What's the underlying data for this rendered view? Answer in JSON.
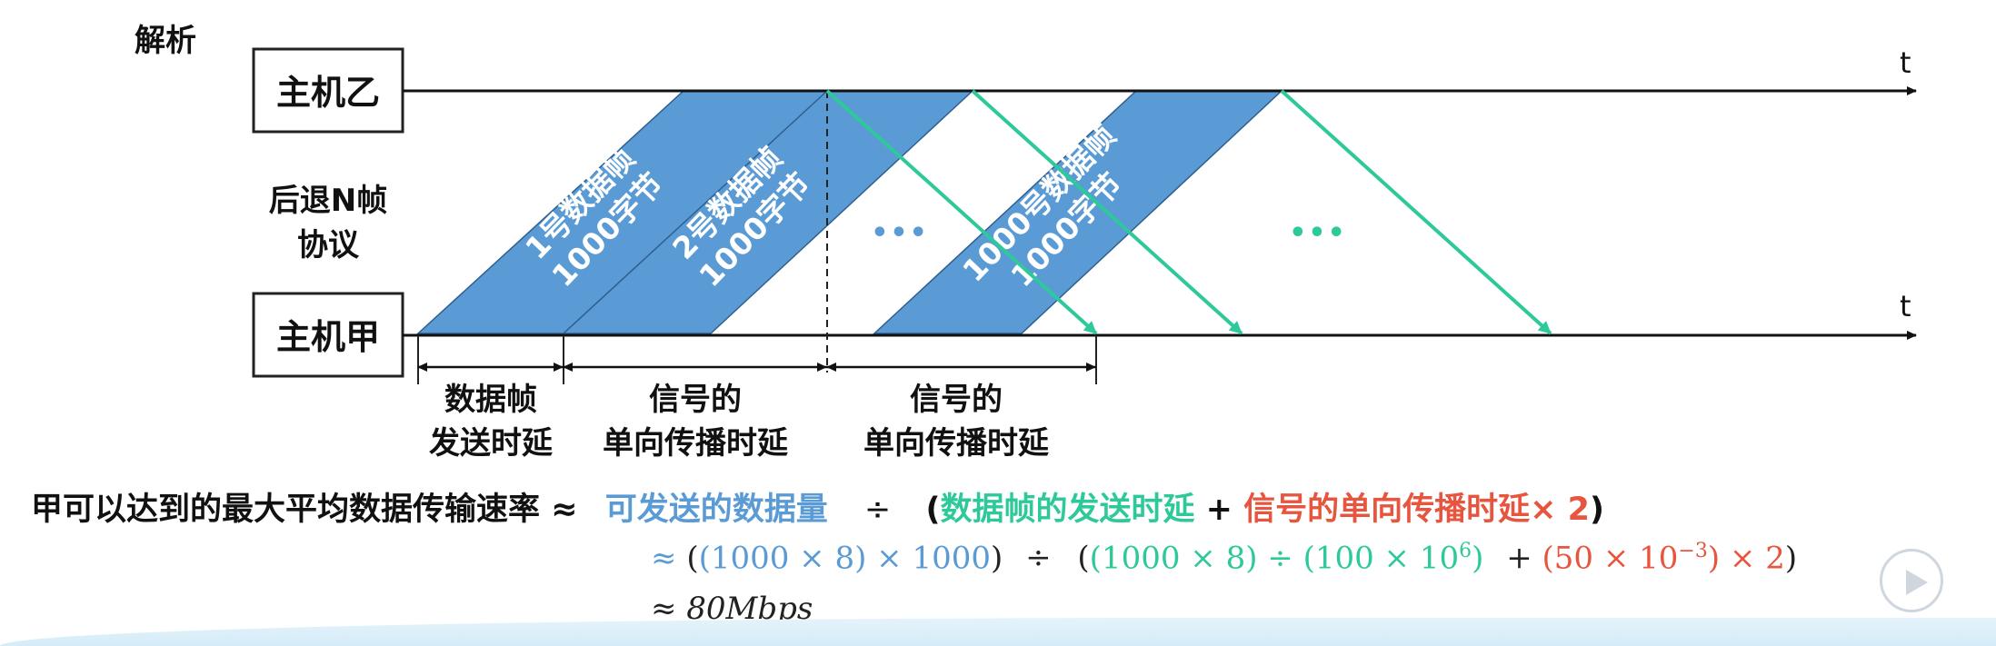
{
  "header": {
    "title": "解析"
  },
  "hosts": {
    "receiver": "主机乙",
    "sender": "主机甲",
    "time_label": "t"
  },
  "protocol": {
    "line1": "后退N帧",
    "line2": "协议"
  },
  "frames": [
    {
      "line1": "1号数据帧",
      "line2": "1000字节"
    },
    {
      "line1": "2号数据帧",
      "line2": "1000字节"
    },
    {
      "line1": "1000号数据帧",
      "line2": "1000字节"
    }
  ],
  "ellipsis": "•••",
  "intervals": [
    {
      "line1": "数据帧",
      "line2": "发送时延"
    },
    {
      "line1": "信号的",
      "line2": "单向传播时延"
    },
    {
      "line1": "信号的",
      "line2": "单向传播时延"
    }
  ],
  "formula": {
    "lhs": "甲可以达到的最大平均数据传输速率",
    "approx": "≈",
    "data_amount": "可发送的数据量",
    "div": "÷",
    "open": "(",
    "tx_delay": "数据帧的发送时延",
    "plus": "+",
    "prop_delay": "信号的单向传播时延",
    "times_two": "× 2",
    "close": ")"
  },
  "calc": {
    "approx": "≈",
    "open": "(",
    "part_a": "(1000 × 8) × 1000",
    "close": ")",
    "div": "÷",
    "open2": "(",
    "part_b": "(1000 × 8) ÷ (100 × 10",
    "exp_b": "6",
    "part_b_end": ")",
    "plus": "+",
    "part_c": "(50 × 10",
    "exp_c": "−3",
    "part_c_end": ") × 2",
    "close2": ")"
  },
  "result": "≈ 80Mbps",
  "colors": {
    "frame_fill": "#5b9bd5",
    "ack_arrow": "#2ec99a",
    "blue_text": "#5b9bd5",
    "green_text": "#2ec99a",
    "red_text": "#e8553f"
  }
}
